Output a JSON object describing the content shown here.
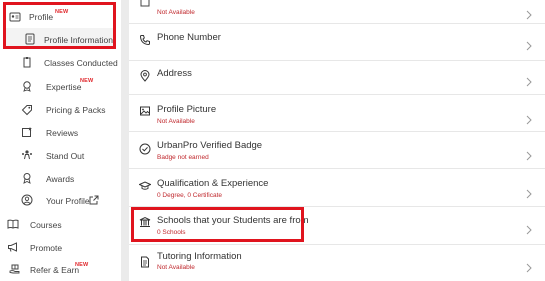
{
  "sidebar": {
    "new_badge": "NEW",
    "items": [
      {
        "label": "Profile",
        "icon": "id-card-icon"
      },
      {
        "label": "Profile Information",
        "icon": "profile-card-icon"
      },
      {
        "label": "Classes Conducted",
        "icon": "clipboard-icon"
      },
      {
        "label": "Expertise",
        "icon": "award-medal-icon"
      },
      {
        "label": "Pricing & Packs",
        "icon": "price-tag-icon"
      },
      {
        "label": "Reviews",
        "icon": "reviews-icon"
      },
      {
        "label": "Stand Out",
        "icon": "users-icon"
      },
      {
        "label": "Awards",
        "icon": "ribbon-icon"
      },
      {
        "label": "Your Profile",
        "icon": "user-circle-icon"
      },
      {
        "label": "Courses",
        "icon": "book-icon"
      },
      {
        "label": "Promote",
        "icon": "megaphone-icon"
      },
      {
        "label": "Refer & Earn",
        "icon": "gift-hand-icon"
      }
    ]
  },
  "main": {
    "rows": [
      {
        "title": "",
        "subtitle": "Not Available"
      },
      {
        "title": "Phone Number",
        "subtitle": ""
      },
      {
        "title": "Address",
        "subtitle": ""
      },
      {
        "title": "Profile Picture",
        "subtitle": "Not Available"
      },
      {
        "title": "UrbanPro Verified Badge",
        "subtitle": "Badge not earned"
      },
      {
        "title": "Qualification & Experience",
        "subtitle": "0 Degree, 0 Certificate"
      },
      {
        "title": "Schools that your Students are from",
        "subtitle": "0 Schools"
      },
      {
        "title": "Tutoring Information",
        "subtitle": "Not Available"
      }
    ]
  },
  "colors": {
    "highlight": "#e0141e",
    "status_red": "#c0282d",
    "new_badge": "#e0282d",
    "divider": "#e7e7e7",
    "gutter": "#ebebeb"
  }
}
